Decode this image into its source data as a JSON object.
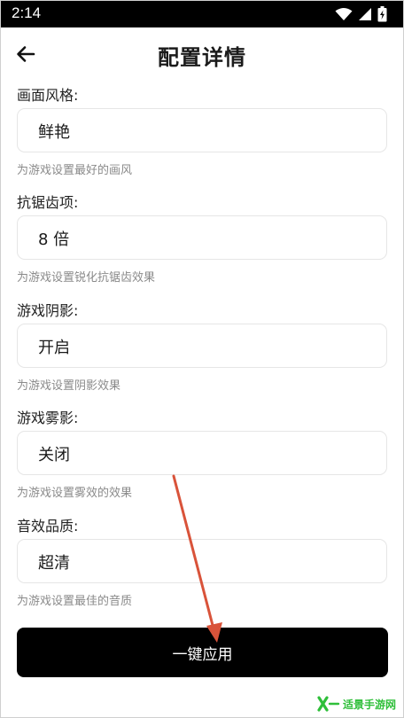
{
  "status_bar": {
    "time": "2:14",
    "icons": [
      "wifi-icon",
      "signal-icon",
      "battery-icon"
    ]
  },
  "header": {
    "title": "配置详情",
    "back_icon": "arrow-left-icon"
  },
  "settings": [
    {
      "label": "画面风格:",
      "value": "鲜艳",
      "hint": "为游戏设置最好的画风"
    },
    {
      "label": "抗锯齿项:",
      "value": "8 倍",
      "hint": "为游戏设置锐化抗锯齿效果"
    },
    {
      "label": "游戏阴影:",
      "value": "开启",
      "hint": "为游戏设置阴影效果"
    },
    {
      "label": "游戏雾影:",
      "value": "关闭",
      "hint": "为游戏设置雾效的效果"
    },
    {
      "label": "音效品质:",
      "value": "超清",
      "hint": "为游戏设置最佳的音质"
    }
  ],
  "apply_button": {
    "label": "一键应用"
  },
  "annotation": {
    "color": "#d9533a"
  },
  "watermark": {
    "text": "适景手游网",
    "color": "#2fbf3a"
  }
}
